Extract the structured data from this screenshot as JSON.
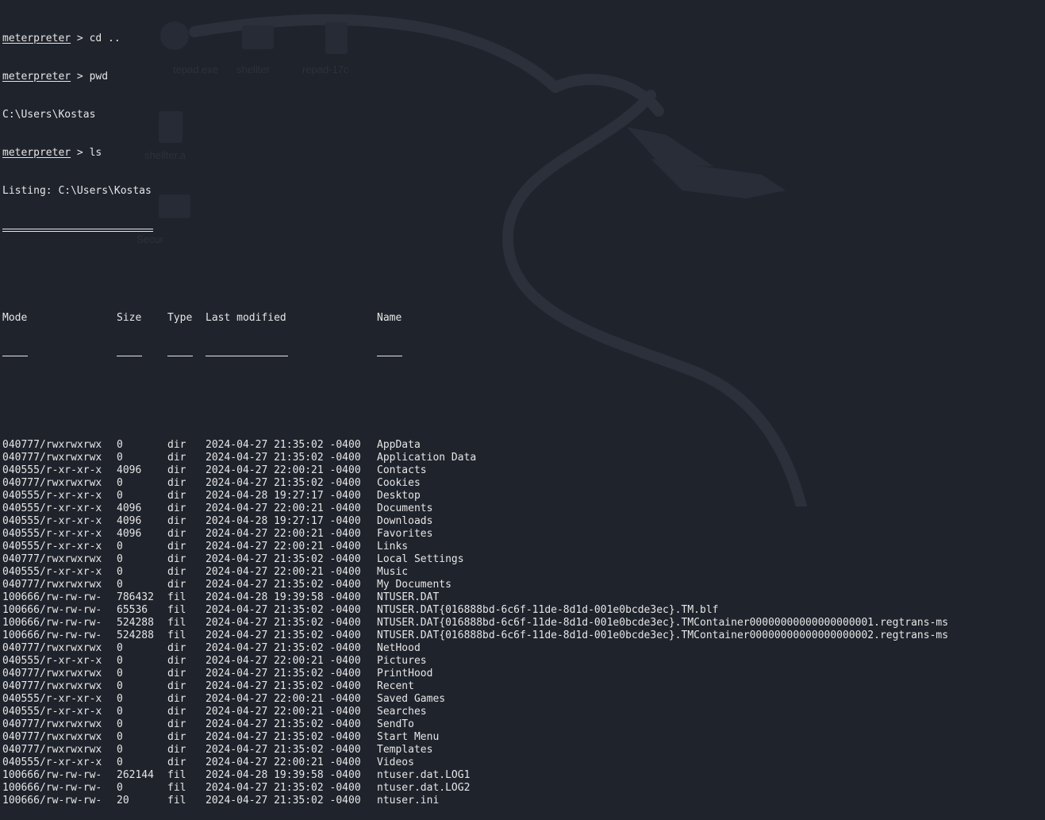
{
  "session": {
    "lines": [
      {
        "prompt": "meterpreter",
        "command": " > cd .."
      },
      {
        "prompt": "meterpreter",
        "command": " > pwd"
      },
      {
        "output": "C:\\Users\\Kostas"
      },
      {
        "prompt": "meterpreter",
        "command": " > ls"
      },
      {
        "output": "Listing: C:\\Users\\Kostas"
      }
    ]
  },
  "table": {
    "headers": {
      "mode": "Mode",
      "size": "Size",
      "type": "Type",
      "modified": "Last modified",
      "name": "Name"
    },
    "rows": [
      {
        "mode": "040777/rwxrwxrwx",
        "size": "0",
        "type": "dir",
        "modified": "2024-04-27 21:35:02 -0400",
        "name": "AppData"
      },
      {
        "mode": "040777/rwxrwxrwx",
        "size": "0",
        "type": "dir",
        "modified": "2024-04-27 21:35:02 -0400",
        "name": "Application Data"
      },
      {
        "mode": "040555/r-xr-xr-x",
        "size": "4096",
        "type": "dir",
        "modified": "2024-04-27 22:00:21 -0400",
        "name": "Contacts"
      },
      {
        "mode": "040777/rwxrwxrwx",
        "size": "0",
        "type": "dir",
        "modified": "2024-04-27 21:35:02 -0400",
        "name": "Cookies"
      },
      {
        "mode": "040555/r-xr-xr-x",
        "size": "0",
        "type": "dir",
        "modified": "2024-04-28 19:27:17 -0400",
        "name": "Desktop"
      },
      {
        "mode": "040555/r-xr-xr-x",
        "size": "4096",
        "type": "dir",
        "modified": "2024-04-27 22:00:21 -0400",
        "name": "Documents"
      },
      {
        "mode": "040555/r-xr-xr-x",
        "size": "4096",
        "type": "dir",
        "modified": "2024-04-28 19:27:17 -0400",
        "name": "Downloads"
      },
      {
        "mode": "040555/r-xr-xr-x",
        "size": "4096",
        "type": "dir",
        "modified": "2024-04-27 22:00:21 -0400",
        "name": "Favorites"
      },
      {
        "mode": "040555/r-xr-xr-x",
        "size": "0",
        "type": "dir",
        "modified": "2024-04-27 22:00:21 -0400",
        "name": "Links"
      },
      {
        "mode": "040777/rwxrwxrwx",
        "size": "0",
        "type": "dir",
        "modified": "2024-04-27 21:35:02 -0400",
        "name": "Local Settings"
      },
      {
        "mode": "040555/r-xr-xr-x",
        "size": "0",
        "type": "dir",
        "modified": "2024-04-27 22:00:21 -0400",
        "name": "Music"
      },
      {
        "mode": "040777/rwxrwxrwx",
        "size": "0",
        "type": "dir",
        "modified": "2024-04-27 21:35:02 -0400",
        "name": "My Documents"
      },
      {
        "mode": "100666/rw-rw-rw-",
        "size": "786432",
        "type": "fil",
        "modified": "2024-04-28 19:39:58 -0400",
        "name": "NTUSER.DAT"
      },
      {
        "mode": "100666/rw-rw-rw-",
        "size": "65536",
        "type": "fil",
        "modified": "2024-04-27 21:35:02 -0400",
        "name": "NTUSER.DAT{016888bd-6c6f-11de-8d1d-001e0bcde3ec}.TM.blf"
      },
      {
        "mode": "100666/rw-rw-rw-",
        "size": "524288",
        "type": "fil",
        "modified": "2024-04-27 21:35:02 -0400",
        "name": "NTUSER.DAT{016888bd-6c6f-11de-8d1d-001e0bcde3ec}.TMContainer00000000000000000001.regtrans-ms"
      },
      {
        "mode": "100666/rw-rw-rw-",
        "size": "524288",
        "type": "fil",
        "modified": "2024-04-27 21:35:02 -0400",
        "name": "NTUSER.DAT{016888bd-6c6f-11de-8d1d-001e0bcde3ec}.TMContainer00000000000000000002.regtrans-ms"
      },
      {
        "mode": "040777/rwxrwxrwx",
        "size": "0",
        "type": "dir",
        "modified": "2024-04-27 21:35:02 -0400",
        "name": "NetHood"
      },
      {
        "mode": "040555/r-xr-xr-x",
        "size": "0",
        "type": "dir",
        "modified": "2024-04-27 22:00:21 -0400",
        "name": "Pictures"
      },
      {
        "mode": "040777/rwxrwxrwx",
        "size": "0",
        "type": "dir",
        "modified": "2024-04-27 21:35:02 -0400",
        "name": "PrintHood"
      },
      {
        "mode": "040777/rwxrwxrwx",
        "size": "0",
        "type": "dir",
        "modified": "2024-04-27 21:35:02 -0400",
        "name": "Recent"
      },
      {
        "mode": "040555/r-xr-xr-x",
        "size": "0",
        "type": "dir",
        "modified": "2024-04-27 22:00:21 -0400",
        "name": "Saved Games"
      },
      {
        "mode": "040555/r-xr-xr-x",
        "size": "0",
        "type": "dir",
        "modified": "2024-04-27 22:00:21 -0400",
        "name": "Searches"
      },
      {
        "mode": "040777/rwxrwxrwx",
        "size": "0",
        "type": "dir",
        "modified": "2024-04-27 21:35:02 -0400",
        "name": "SendTo"
      },
      {
        "mode": "040777/rwxrwxrwx",
        "size": "0",
        "type": "dir",
        "modified": "2024-04-27 21:35:02 -0400",
        "name": "Start Menu"
      },
      {
        "mode": "040777/rwxrwxrwx",
        "size": "0",
        "type": "dir",
        "modified": "2024-04-27 21:35:02 -0400",
        "name": "Templates"
      },
      {
        "mode": "040555/r-xr-xr-x",
        "size": "0",
        "type": "dir",
        "modified": "2024-04-27 22:00:21 -0400",
        "name": "Videos"
      },
      {
        "mode": "100666/rw-rw-rw-",
        "size": "262144",
        "type": "fil",
        "modified": "2024-04-28 19:39:58 -0400",
        "name": "ntuser.dat.LOG1"
      },
      {
        "mode": "100666/rw-rw-rw-",
        "size": "0",
        "type": "fil",
        "modified": "2024-04-27 21:35:02 -0400",
        "name": "ntuser.dat.LOG2"
      },
      {
        "mode": "100666/rw-rw-rw-",
        "size": "20",
        "type": "fil",
        "modified": "2024-04-27 21:35:02 -0400",
        "name": "ntuser.ini"
      }
    ]
  },
  "background": {
    "ghost_labels": [
      "tepad.exe",
      "shellter",
      "repad-17c",
      "shellter.a",
      "Secur"
    ]
  },
  "colors": {
    "background": "#1f232c",
    "text": "#e6e6e6",
    "art": "#2b303b"
  }
}
